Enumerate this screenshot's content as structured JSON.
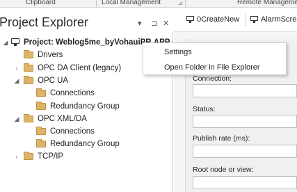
{
  "ribbon": {
    "groups": [
      "Clipboard",
      "Local Management",
      "Remote Management"
    ]
  },
  "explorer": {
    "title": "Project Explorer",
    "dropdown_icon": "▾",
    "pin_icon": "⊐",
    "close_icon": "✕",
    "items": [
      {
        "label": "Project: Weblog5me_byVohauiPR.APP",
        "depth": 0,
        "expanded": true,
        "bold": true,
        "icon": "monitor-icon"
      },
      {
        "label": "Drivers",
        "depth": 1,
        "expanded": null,
        "icon": "folder-icon"
      },
      {
        "label": "OPC DA Client (legacy)",
        "depth": 1,
        "expanded": false,
        "icon": "folder-icon"
      },
      {
        "label": "OPC UA",
        "depth": 1,
        "expanded": true,
        "icon": "folder-icon"
      },
      {
        "label": "Connections",
        "depth": 2,
        "expanded": null,
        "icon": "folder-icon"
      },
      {
        "label": "Redundancy Group",
        "depth": 2,
        "expanded": null,
        "icon": "folder-icon"
      },
      {
        "label": "OPC XML/DA",
        "depth": 1,
        "expanded": true,
        "icon": "folder-icon"
      },
      {
        "label": "Connections",
        "depth": 2,
        "expanded": null,
        "icon": "folder-icon"
      },
      {
        "label": "Redundancy Group",
        "depth": 2,
        "expanded": null,
        "icon": "folder-icon"
      },
      {
        "label": "TCP/IP",
        "depth": 1,
        "expanded": false,
        "icon": "folder-icon"
      }
    ]
  },
  "tabs": [
    {
      "label": "0CreateNew",
      "icon": "monitor-icon"
    },
    {
      "label": "AlarmScreen",
      "icon": "monitor-icon"
    }
  ],
  "form": {
    "fields": [
      {
        "label": "Connection:",
        "value": ""
      },
      {
        "label": "Status:",
        "value": ""
      },
      {
        "label": "Publish rate (ms):",
        "value": ""
      },
      {
        "label": "Root node or view:",
        "value": ""
      }
    ]
  },
  "context_menu": {
    "items": [
      "Settings",
      "Open Folder in File Explorer"
    ]
  }
}
